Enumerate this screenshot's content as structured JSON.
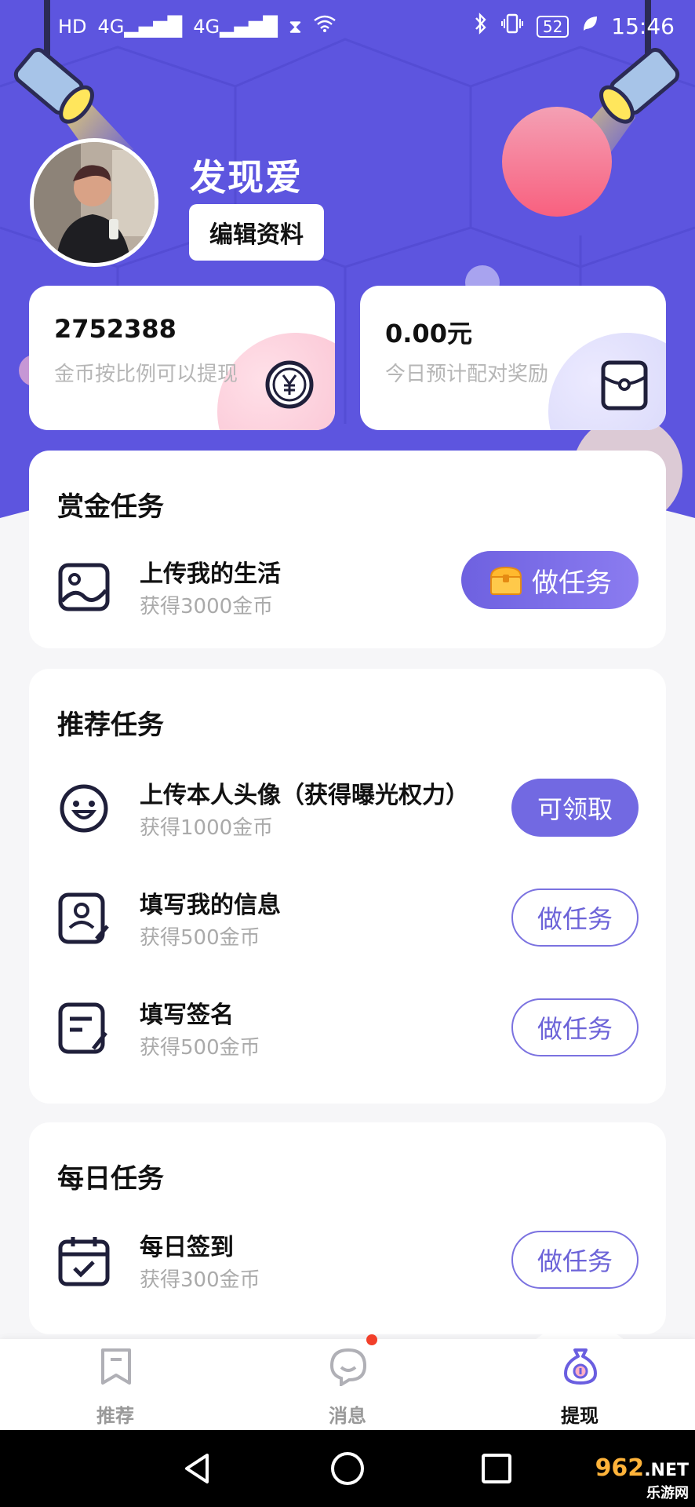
{
  "status_bar": {
    "left_icons": [
      "hd-icon",
      "signal-4g-icon",
      "signal-4g-icon",
      "hourglass-icon",
      "wifi-icon"
    ],
    "left_labels": [
      "HD",
      "4G",
      "4G"
    ],
    "battery": "52",
    "time": "15:46"
  },
  "profile": {
    "name": "发现爱",
    "edit_label": "编辑资料"
  },
  "stats": {
    "coins": {
      "value": "2752388",
      "desc": "金币按比例可以提现"
    },
    "reward": {
      "value": "0.00元",
      "desc": "今日预计配对奖励"
    }
  },
  "bounty": {
    "title": "赏金任务",
    "tasks": [
      {
        "name": "上传我的生活",
        "reward": "获得3000金币",
        "button": "做任务"
      }
    ]
  },
  "recommended": {
    "title": "推荐任务",
    "tasks": [
      {
        "name": "上传本人头像（获得曝光权力）",
        "reward": "获得1000金币",
        "button": "可领取"
      },
      {
        "name": "填写我的信息",
        "reward": "获得500金币",
        "button": "做任务"
      },
      {
        "name": "填写签名",
        "reward": "获得500金币",
        "button": "做任务"
      }
    ]
  },
  "daily": {
    "title": "每日任务",
    "tasks": [
      {
        "name": "每日签到",
        "reward": "获得300金币",
        "button": "做任务"
      }
    ]
  },
  "bottom_nav": {
    "items": [
      {
        "label": "推荐",
        "icon": "bookmark-icon"
      },
      {
        "label": "消息",
        "icon": "chat-bubble-icon"
      },
      {
        "label": "提现",
        "icon": "money-bag-icon"
      }
    ],
    "active": "提现"
  },
  "watermark": {
    "brand": "962",
    "suffix": ".NET",
    "sub": "乐游网"
  },
  "colors": {
    "header_bg": "#5c55e0",
    "accent": "#7269e2",
    "pink_ball": "#f86a8f"
  }
}
